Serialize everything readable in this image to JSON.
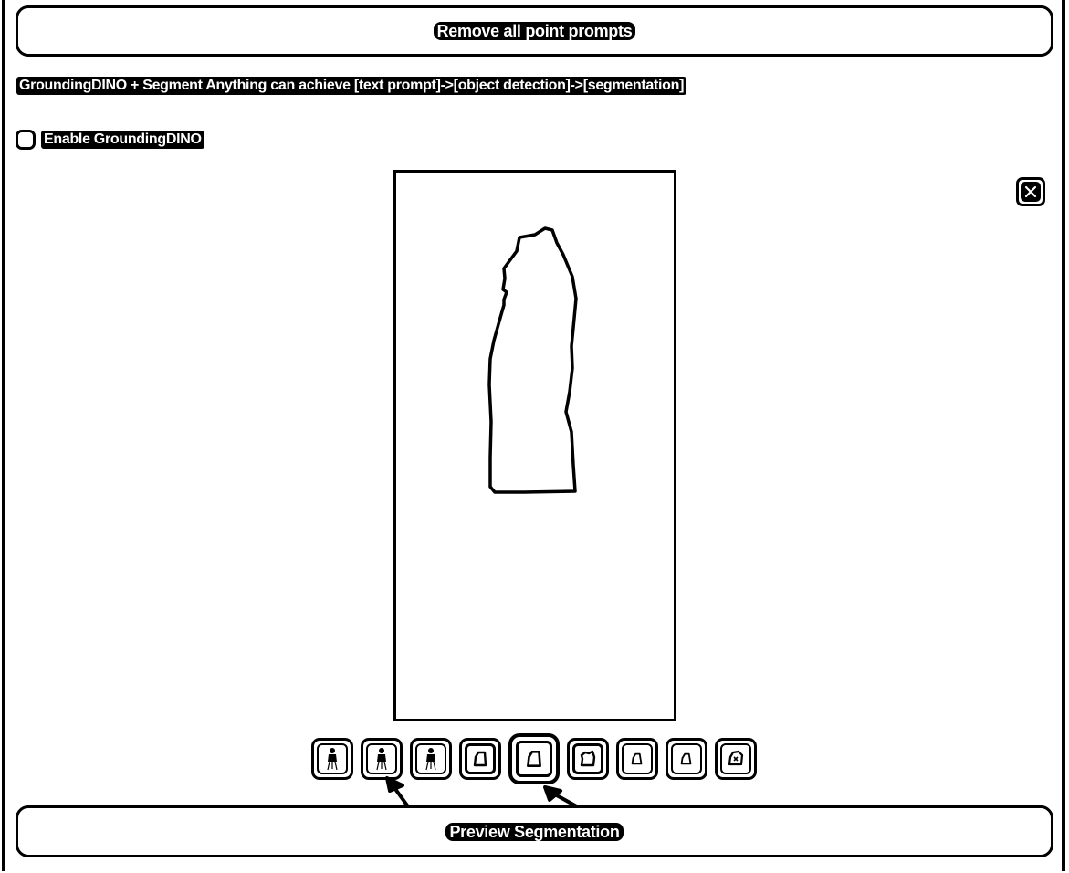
{
  "remove_button": {
    "label": "Remove all point prompts"
  },
  "description": "GroundingDINO + Segment Anything can achieve [text prompt]->[object detection]->[segmentation]",
  "grounding_dino": {
    "checkbox_label": "Enable GroundingDINO",
    "checked": false
  },
  "preview_button": {
    "label": "Preview Segmentation"
  },
  "gallery": {
    "thumbnails": [
      {
        "icon": "figure-image-icon",
        "style": "light"
      },
      {
        "icon": "figure-image-icon",
        "style": "light"
      },
      {
        "icon": "figure-image-icon",
        "style": "light"
      },
      {
        "icon": "mask-image-icon",
        "style": "dark"
      },
      {
        "icon": "mask-image-icon",
        "style": "dark",
        "selected": true
      },
      {
        "icon": "mask-image-icon",
        "style": "dark"
      },
      {
        "icon": "mask-image-icon",
        "style": "light"
      },
      {
        "icon": "mask-image-icon",
        "style": "light"
      },
      {
        "icon": "mask-image-icon",
        "style": "light"
      }
    ]
  },
  "close_icon": "close-icon"
}
